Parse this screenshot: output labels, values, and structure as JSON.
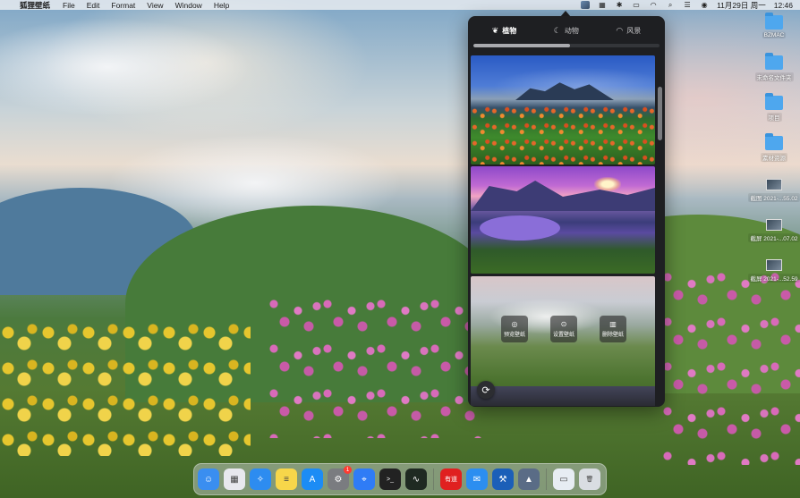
{
  "menubar": {
    "app_name": "狐狸壁纸",
    "menus": [
      "File",
      "Edit",
      "Format",
      "View",
      "Window",
      "Help"
    ],
    "datetime": "11月29日 周一",
    "time": "12:46"
  },
  "panel": {
    "tabs": [
      {
        "label": "植物",
        "icon": "leaf-icon",
        "active": true
      },
      {
        "label": "动物",
        "icon": "moon-icon",
        "active": false
      },
      {
        "label": "风景",
        "icon": "wifi-icon",
        "active": false
      }
    ],
    "progress_fraction": 0.52,
    "actions": {
      "preview": "预览壁纸",
      "set": "设置壁纸",
      "delete": "删除壁纸"
    }
  },
  "desktop": {
    "icons": [
      {
        "label": "BZMAC",
        "type": "folder"
      },
      {
        "label": "未命名文件夹",
        "type": "folder"
      },
      {
        "label": "项目",
        "type": "folder"
      },
      {
        "label": "素材资源",
        "type": "folder"
      },
      {
        "label": "截图 2021-...55.02",
        "type": "screenshot"
      },
      {
        "label": "截屏 2021-...07.02",
        "type": "screenshot"
      },
      {
        "label": "截屏 2021-...52.59",
        "type": "screenshot"
      }
    ]
  },
  "dock": {
    "apps": [
      {
        "name": "Finder",
        "icon": "finder-icon",
        "color": "#3a8ef0",
        "glyph": "☺"
      },
      {
        "name": "Launchpad",
        "icon": "launchpad-icon",
        "color": "#e8e8ee",
        "glyph": "▦"
      },
      {
        "name": "Safari",
        "icon": "safari-icon",
        "color": "#2d8cf0",
        "glyph": "✧"
      },
      {
        "name": "Notes",
        "icon": "notes-icon",
        "color": "#f7d64a",
        "glyph": "≡"
      },
      {
        "name": "App Store",
        "icon": "appstore-icon",
        "color": "#1c8cf5",
        "glyph": "A"
      },
      {
        "name": "System Preferences",
        "icon": "settings-icon",
        "color": "#7a7c80",
        "glyph": "⚙",
        "badge": "1"
      },
      {
        "name": "Maps",
        "icon": "map-pin-icon",
        "color": "#2f7cf6",
        "glyph": "⌖"
      },
      {
        "name": "Terminal",
        "icon": "terminal-icon",
        "color": "#222",
        "glyph": ">_"
      },
      {
        "name": "Activity Monitor",
        "icon": "activity-icon",
        "color": "#1f2a22",
        "glyph": "∿"
      },
      {
        "name": "有道",
        "icon": "youdao-icon",
        "color": "#e02020",
        "glyph": "有道"
      },
      {
        "name": "Mail",
        "icon": "mail-icon",
        "color": "#2c8ef0",
        "glyph": "✉"
      },
      {
        "name": "Xcode",
        "icon": "xcode-icon",
        "color": "#1b5fb8",
        "glyph": "⚒"
      },
      {
        "name": "狐狸壁纸",
        "icon": "wallpaper-app-icon",
        "color": "#5a6c86",
        "glyph": "▲"
      },
      {
        "name": "Downloads",
        "icon": "downloads-icon",
        "color": "#e7edf3",
        "glyph": "▭"
      },
      {
        "name": "Trash",
        "icon": "trash-icon",
        "color": "#d9dde2",
        "glyph": "🗑"
      }
    ]
  }
}
